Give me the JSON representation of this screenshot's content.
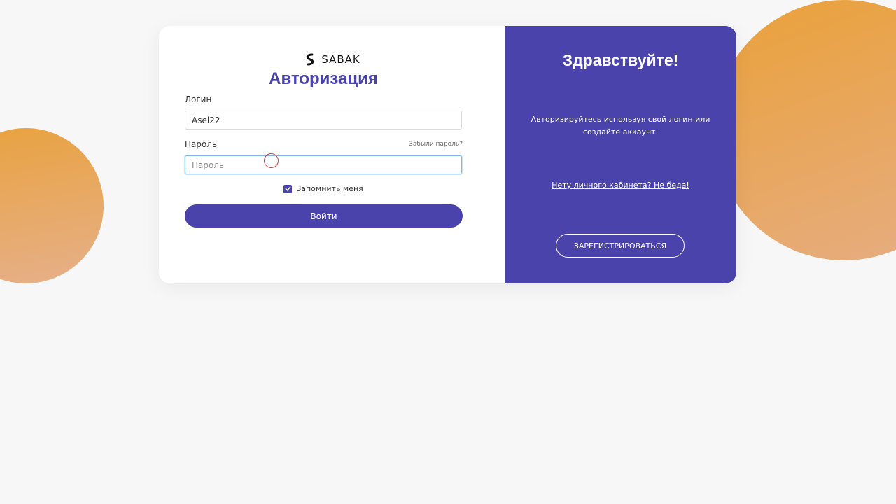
{
  "brand": {
    "name": "SABAK",
    "accent_color": "#4a43ab",
    "orange_color": "#e9a23e",
    "logo_icon": "sabak-logo-icon"
  },
  "login_form": {
    "title": "Авторизация",
    "login_label": "Логин",
    "login_value": "Asel22",
    "password_label": "Пароль",
    "forgot_password": "Забыли пароль?",
    "password_placeholder": "Пароль",
    "remember_me": "Запомнить меня",
    "remember_checked": true,
    "submit_label": "Войти"
  },
  "welcome_panel": {
    "greeting": "Здравствуйте!",
    "description": "Авторизируйтесь используя свой логин или создайте аккаунт.",
    "no_account_link": "Нету личного кабинета? Не беда!",
    "register_label": "ЗАРЕГИСТРИРОВАТЬСЯ"
  }
}
